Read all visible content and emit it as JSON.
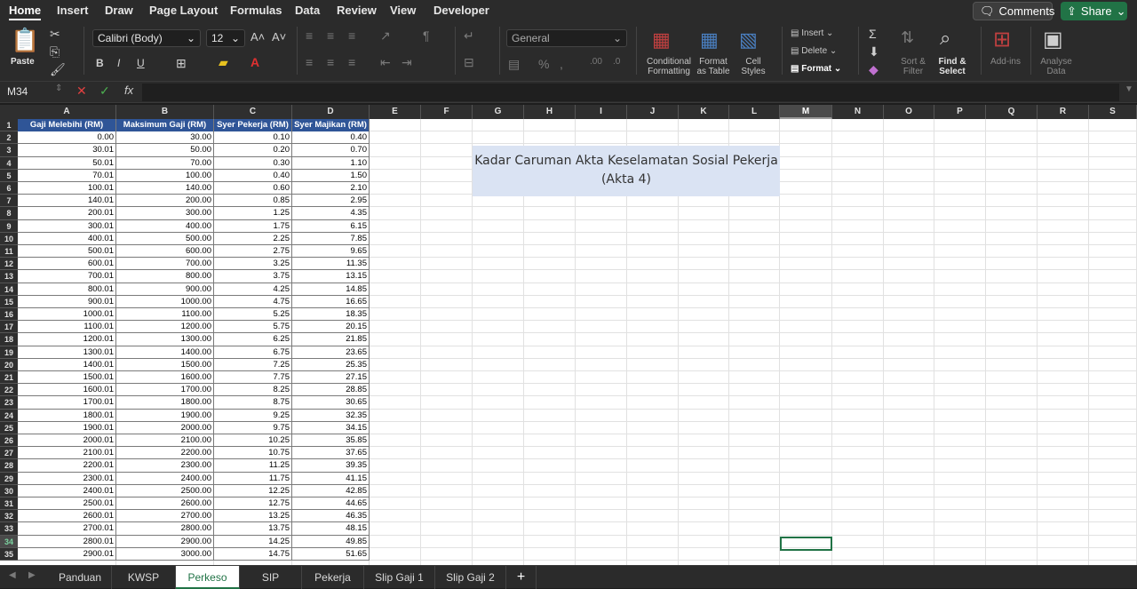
{
  "menu": {
    "tabs": [
      "Home",
      "Insert",
      "Draw",
      "Page Layout",
      "Formulas",
      "Data",
      "Review",
      "View",
      "Developer"
    ],
    "comments": "Comments",
    "share": "Share"
  },
  "ribbon": {
    "paste": "Paste",
    "font": "Calibri (Body)",
    "size": "12",
    "number_format": "General",
    "conditional": "Conditional\nFormatting",
    "format_table": "Format\nas Table",
    "cell_styles": "Cell\nStyles",
    "insert": "Insert",
    "delete": "Delete",
    "format": "Format",
    "sort": "Sort &\nFilter",
    "find": "Find &\nSelect",
    "addins": "Add-ins",
    "analyse": "Analyse\nData"
  },
  "formula_bar": {
    "name_box": "M34",
    "fx": "fx",
    "value": ""
  },
  "columns": [
    "A",
    "B",
    "C",
    "D",
    "E",
    "F",
    "G",
    "H",
    "I",
    "J",
    "K",
    "L",
    "M",
    "N",
    "O",
    "P",
    "Q",
    "R",
    "S"
  ],
  "table_headers": [
    "Gaji Melebihi (RM)",
    "Maksimum Gaji (RM)",
    "Syer Pekerja (RM)",
    "Syer Majikan (RM)"
  ],
  "rows": [
    [
      "0.00",
      "30.00",
      "0.10",
      "0.40"
    ],
    [
      "30.01",
      "50.00",
      "0.20",
      "0.70"
    ],
    [
      "50.01",
      "70.00",
      "0.30",
      "1.10"
    ],
    [
      "70.01",
      "100.00",
      "0.40",
      "1.50"
    ],
    [
      "100.01",
      "140.00",
      "0.60",
      "2.10"
    ],
    [
      "140.01",
      "200.00",
      "0.85",
      "2.95"
    ],
    [
      "200.01",
      "300.00",
      "1.25",
      "4.35"
    ],
    [
      "300.01",
      "400.00",
      "1.75",
      "6.15"
    ],
    [
      "400.01",
      "500.00",
      "2.25",
      "7.85"
    ],
    [
      "500.01",
      "600.00",
      "2.75",
      "9.65"
    ],
    [
      "600.01",
      "700.00",
      "3.25",
      "11.35"
    ],
    [
      "700.01",
      "800.00",
      "3.75",
      "13.15"
    ],
    [
      "800.01",
      "900.00",
      "4.25",
      "14.85"
    ],
    [
      "900.01",
      "1000.00",
      "4.75",
      "16.65"
    ],
    [
      "1000.01",
      "1100.00",
      "5.25",
      "18.35"
    ],
    [
      "1100.01",
      "1200.00",
      "5.75",
      "20.15"
    ],
    [
      "1200.01",
      "1300.00",
      "6.25",
      "21.85"
    ],
    [
      "1300.01",
      "1400.00",
      "6.75",
      "23.65"
    ],
    [
      "1400.01",
      "1500.00",
      "7.25",
      "25.35"
    ],
    [
      "1500.01",
      "1600.00",
      "7.75",
      "27.15"
    ],
    [
      "1600.01",
      "1700.00",
      "8.25",
      "28.85"
    ],
    [
      "1700.01",
      "1800.00",
      "8.75",
      "30.65"
    ],
    [
      "1800.01",
      "1900.00",
      "9.25",
      "32.35"
    ],
    [
      "1900.01",
      "2000.00",
      "9.75",
      "34.15"
    ],
    [
      "2000.01",
      "2100.00",
      "10.25",
      "35.85"
    ],
    [
      "2100.01",
      "2200.00",
      "10.75",
      "37.65"
    ],
    [
      "2200.01",
      "2300.00",
      "11.25",
      "39.35"
    ],
    [
      "2300.01",
      "2400.00",
      "11.75",
      "41.15"
    ],
    [
      "2400.01",
      "2500.00",
      "12.25",
      "42.85"
    ],
    [
      "2500.01",
      "2600.00",
      "12.75",
      "44.65"
    ],
    [
      "2600.01",
      "2700.00",
      "13.25",
      "46.35"
    ],
    [
      "2700.01",
      "2800.00",
      "13.75",
      "48.15"
    ],
    [
      "2800.01",
      "2900.00",
      "14.25",
      "49.85"
    ],
    [
      "2900.01",
      "3000.00",
      "14.75",
      "51.65"
    ]
  ],
  "title_box": {
    "line1": "Kadar Caruman Akta Keselamatan Sosial Pekerja",
    "line2": "(Akta 4)"
  },
  "sheets": [
    "Panduan",
    "KWSP",
    "Perkeso",
    "SIP",
    "Pekerja",
    "Slip Gaji 1",
    "Slip Gaji 2"
  ],
  "active_sheet": "Perkeso",
  "accent": "#217346",
  "header_fill": "#2f5597",
  "title_fill": "#dae3f3"
}
